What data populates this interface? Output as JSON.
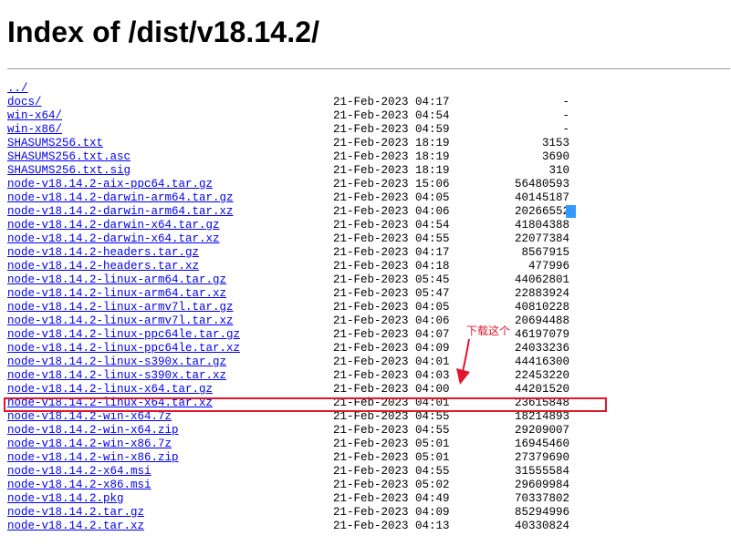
{
  "page": {
    "title": "Index of /dist/v18.14.2/"
  },
  "listing": [
    {
      "name": "../",
      "date": "",
      "size": ""
    },
    {
      "name": "docs/",
      "date": "21-Feb-2023 04:17",
      "size": "-"
    },
    {
      "name": "win-x64/",
      "date": "21-Feb-2023 04:54",
      "size": "-"
    },
    {
      "name": "win-x86/",
      "date": "21-Feb-2023 04:59",
      "size": "-"
    },
    {
      "name": "SHASUMS256.txt",
      "date": "21-Feb-2023 18:19",
      "size": "3153"
    },
    {
      "name": "SHASUMS256.txt.asc",
      "date": "21-Feb-2023 18:19",
      "size": "3690"
    },
    {
      "name": "SHASUMS256.txt.sig",
      "date": "21-Feb-2023 18:19",
      "size": "310"
    },
    {
      "name": "node-v18.14.2-aix-ppc64.tar.gz",
      "date": "21-Feb-2023 15:06",
      "size": "56480593"
    },
    {
      "name": "node-v18.14.2-darwin-arm64.tar.gz",
      "date": "21-Feb-2023 04:05",
      "size": "40145187"
    },
    {
      "name": "node-v18.14.2-darwin-arm64.tar.xz",
      "date": "21-Feb-2023 04:06",
      "size": "20266552"
    },
    {
      "name": "node-v18.14.2-darwin-x64.tar.gz",
      "date": "21-Feb-2023 04:54",
      "size": "41804388"
    },
    {
      "name": "node-v18.14.2-darwin-x64.tar.xz",
      "date": "21-Feb-2023 04:55",
      "size": "22077384"
    },
    {
      "name": "node-v18.14.2-headers.tar.gz",
      "date": "21-Feb-2023 04:17",
      "size": "8567915"
    },
    {
      "name": "node-v18.14.2-headers.tar.xz",
      "date": "21-Feb-2023 04:18",
      "size": "477996"
    },
    {
      "name": "node-v18.14.2-linux-arm64.tar.gz",
      "date": "21-Feb-2023 05:45",
      "size": "44062801"
    },
    {
      "name": "node-v18.14.2-linux-arm64.tar.xz",
      "date": "21-Feb-2023 05:47",
      "size": "22883924"
    },
    {
      "name": "node-v18.14.2-linux-armv7l.tar.gz",
      "date": "21-Feb-2023 04:05",
      "size": "40810228"
    },
    {
      "name": "node-v18.14.2-linux-armv7l.tar.xz",
      "date": "21-Feb-2023 04:06",
      "size": "20694488"
    },
    {
      "name": "node-v18.14.2-linux-ppc64le.tar.gz",
      "date": "21-Feb-2023 04:07",
      "size": "46197079"
    },
    {
      "name": "node-v18.14.2-linux-ppc64le.tar.xz",
      "date": "21-Feb-2023 04:09",
      "size": "24033236"
    },
    {
      "name": "node-v18.14.2-linux-s390x.tar.gz",
      "date": "21-Feb-2023 04:01",
      "size": "44416300"
    },
    {
      "name": "node-v18.14.2-linux-s390x.tar.xz",
      "date": "21-Feb-2023 04:03",
      "size": "22453220"
    },
    {
      "name": "node-v18.14.2-linux-x64.tar.gz",
      "date": "21-Feb-2023 04:00",
      "size": "44201520"
    },
    {
      "name": "node-v18.14.2-linux-x64.tar.xz",
      "date": "21-Feb-2023 04:01",
      "size": "23615848"
    },
    {
      "name": "node-v18.14.2-win-x64.7z",
      "date": "21-Feb-2023 04:55",
      "size": "18214893"
    },
    {
      "name": "node-v18.14.2-win-x64.zip",
      "date": "21-Feb-2023 04:55",
      "size": "29209007"
    },
    {
      "name": "node-v18.14.2-win-x86.7z",
      "date": "21-Feb-2023 05:01",
      "size": "16945460"
    },
    {
      "name": "node-v18.14.2-win-x86.zip",
      "date": "21-Feb-2023 05:01",
      "size": "27379690"
    },
    {
      "name": "node-v18.14.2-x64.msi",
      "date": "21-Feb-2023 04:55",
      "size": "31555584"
    },
    {
      "name": "node-v18.14.2-x86.msi",
      "date": "21-Feb-2023 05:02",
      "size": "29609984"
    },
    {
      "name": "node-v18.14.2.pkg",
      "date": "21-Feb-2023 04:49",
      "size": "70337802"
    },
    {
      "name": "node-v18.14.2.tar.gz",
      "date": "21-Feb-2023 04:09",
      "size": "85294996"
    },
    {
      "name": "node-v18.14.2.tar.xz",
      "date": "21-Feb-2023 04:13",
      "size": "40330824"
    }
  ],
  "annotation": {
    "note": "下载这个",
    "color": "#e0162b"
  },
  "colors": {
    "link": "#0000ee",
    "selection": "#3399ff"
  }
}
